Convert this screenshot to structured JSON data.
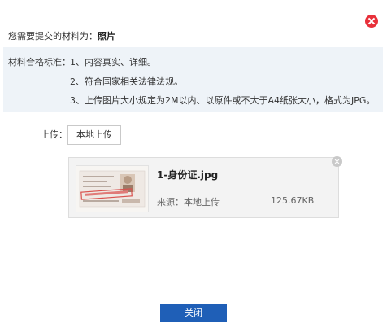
{
  "dialog": {
    "prompt_label": "您需要提交的材料为：",
    "prompt_value": "照片"
  },
  "standards": {
    "label": "材料合格标准：",
    "items": [
      "1、内容真实、详细。",
      "2、符合国家相关法律法规。",
      "3、上传图片大小规定为2M以内、以原件或不大于A4纸张大小，格式为JPG。"
    ]
  },
  "upload": {
    "label": "上传：",
    "button_label": "本地上传"
  },
  "file": {
    "name": "1-身份证.jpg",
    "source": "来源：本地上传",
    "size": "125.67KB"
  },
  "footer": {
    "close_label": "关闭"
  },
  "colors": {
    "accent": "#1f5fb7",
    "close_icon": "#e8303a",
    "panel_bg": "#eef3f8"
  },
  "icons": {
    "dialog_close": "close-icon",
    "file_remove": "close-icon"
  }
}
